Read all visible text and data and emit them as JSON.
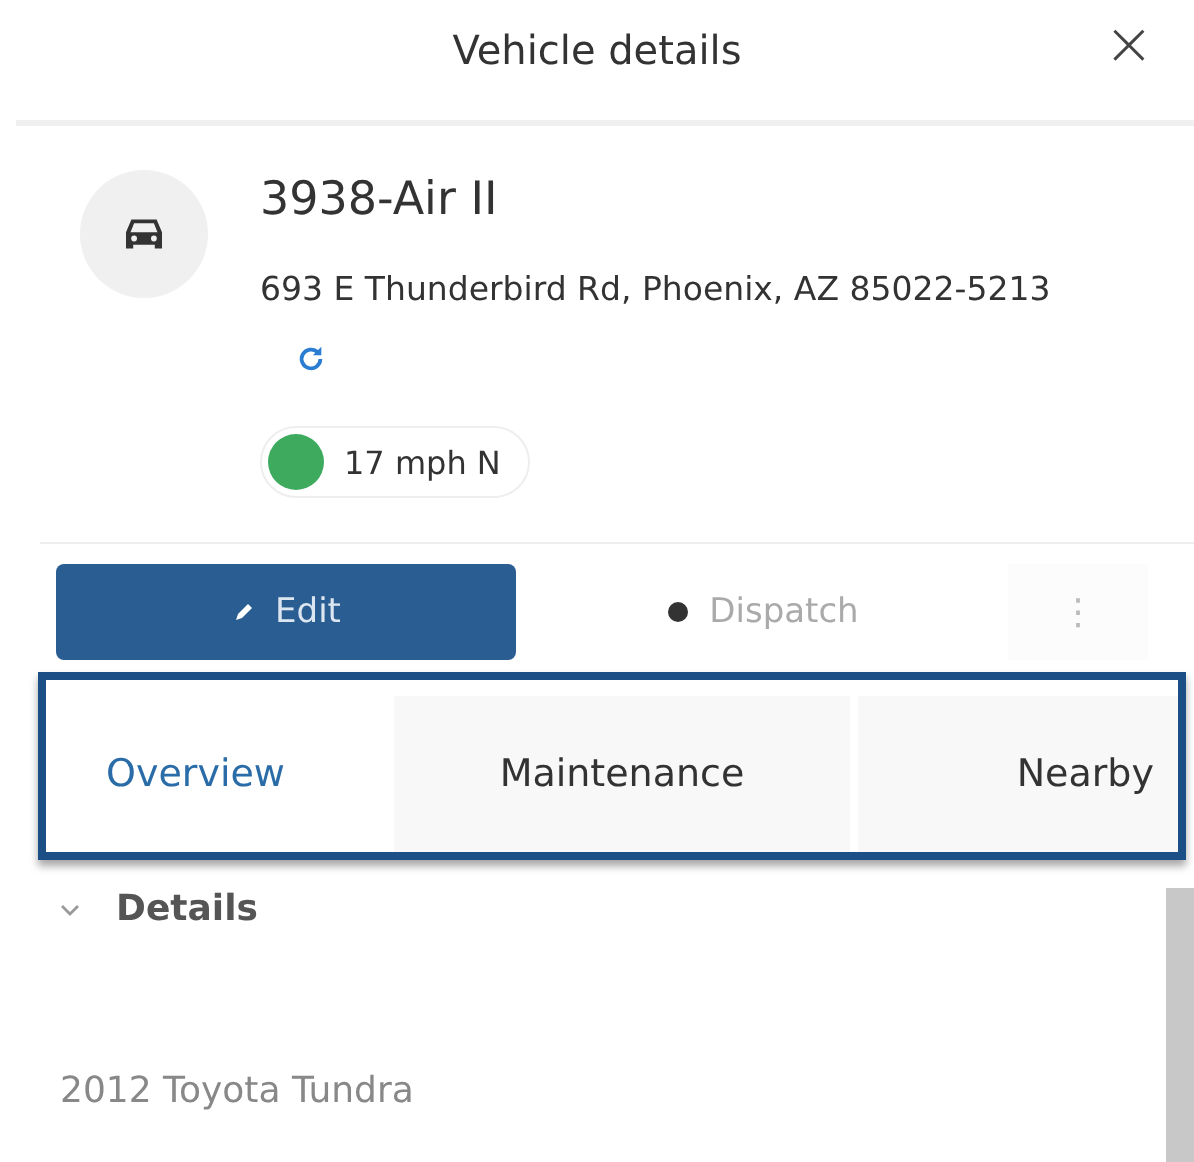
{
  "window": {
    "title": "Vehicle details",
    "close": "×"
  },
  "vehicle": {
    "name": "3938-Air II",
    "address": "693 E Thunderbird Rd, Phoenix, AZ 85022-5213",
    "status": {
      "text": "17 mph N",
      "color": "#3daa5e"
    }
  },
  "actions": [
    {
      "kind": "primary",
      "label": "Edit"
    },
    {
      "kind": "secondary",
      "label": "Dispatch"
    },
    {
      "kind": "more",
      "label": "⋮"
    }
  ],
  "tabs": [
    {
      "label": "Overview",
      "selected": true
    },
    {
      "label": "Maintenance",
      "selected": false
    },
    {
      "label": "Nearby",
      "selected": false
    }
  ],
  "section": {
    "title": "Details",
    "expanded": true,
    "value": "2012 Toyota Tundra"
  }
}
